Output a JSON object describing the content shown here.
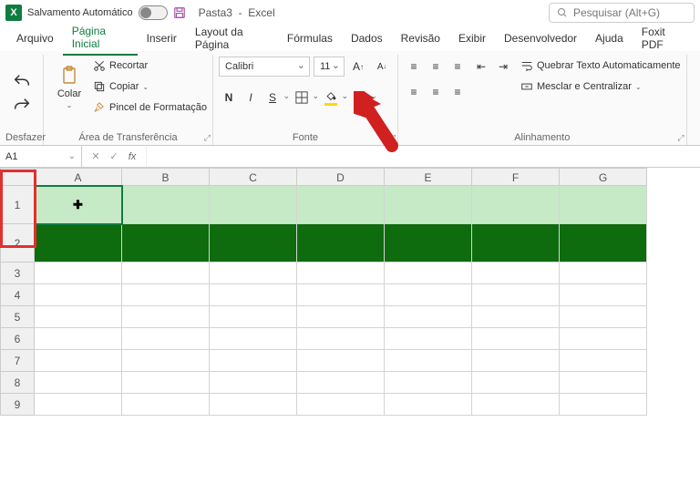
{
  "titlebar": {
    "autosave_label": "Salvamento Automático",
    "filename": "Pasta3",
    "app": "Excel",
    "search_placeholder": "Pesquisar (Alt+G)"
  },
  "menus": [
    "Arquivo",
    "Página Inicial",
    "Inserir",
    "Layout da Página",
    "Fórmulas",
    "Dados",
    "Revisão",
    "Exibir",
    "Desenvolvedor",
    "Ajuda",
    "Foxit PDF"
  ],
  "active_menu": 1,
  "ribbon": {
    "undo": {
      "label": "Desfazer"
    },
    "clipboard": {
      "paste_label": "Colar",
      "cut": "Recortar",
      "copy": "Copiar",
      "format_painter": "Pincel de Formatação",
      "group_label": "Área de Transferência"
    },
    "font": {
      "name": "Calibri",
      "size": "11",
      "bold": "N",
      "italic": "I",
      "underline": "S",
      "group_label": "Fonte"
    },
    "alignment": {
      "wrap": "Quebrar Texto Automaticamente",
      "merge": "Mesclar e Centralizar",
      "group_label": "Alinhamento"
    }
  },
  "namebox": "A1",
  "columns": [
    "A",
    "B",
    "C",
    "D",
    "E",
    "F",
    "G"
  ],
  "rows": [
    "1",
    "2",
    "3",
    "4",
    "5",
    "6",
    "7",
    "8",
    "9"
  ],
  "row_colors": {
    "1": "#c6e9c6",
    "2": "#0e6b0e"
  }
}
